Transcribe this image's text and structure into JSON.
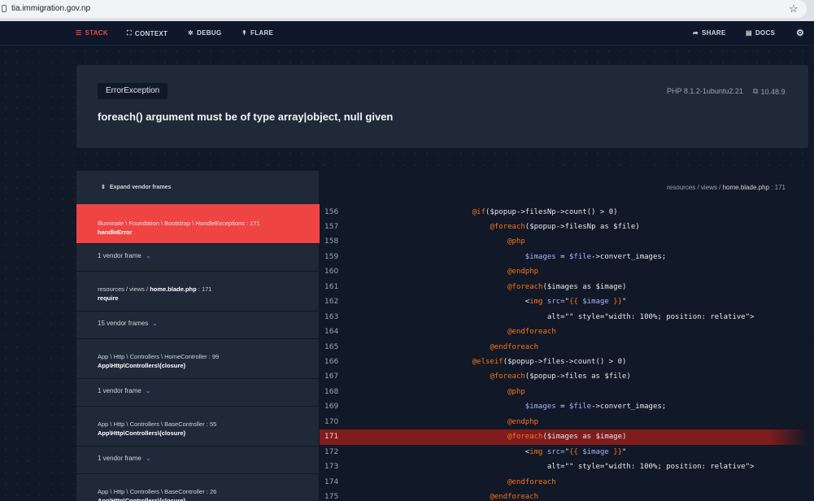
{
  "browser": {
    "url": "tia.immigration.gov.np"
  },
  "nav": {
    "stack": "STACK",
    "context": "CONTEXT",
    "debug": "DEBUG",
    "flare": "FLARE",
    "share": "SHARE",
    "docs": "DOCS"
  },
  "error": {
    "class": "ErrorException",
    "php_version": "PHP 8.1.2-1ubuntu2.21",
    "laravel_version": "10.48.9",
    "message": "foreach() argument must be of type array|object, null given"
  },
  "frames": {
    "expand_label": "Expand vendor frames",
    "items": [
      {
        "type": "frame",
        "path": "Illuminate \\ Foundation \\ Bootstrap \\ HandleExceptions : 171",
        "fn": "handleError",
        "active": true
      },
      {
        "type": "vendor",
        "label": "1 vendor frame"
      },
      {
        "type": "frame",
        "path_prefix": "resources / views / ",
        "path_file": "home.blade.php",
        "path_suffix": " : 171",
        "fn": "require"
      },
      {
        "type": "vendor",
        "label": "15 vendor frames"
      },
      {
        "type": "frame",
        "path": "App \\ Http \\ Controllers \\ HomeController : 99",
        "fn": "App\\Http\\Controllers\\{closure}"
      },
      {
        "type": "vendor",
        "label": "1 vendor frame"
      },
      {
        "type": "frame",
        "path": "App \\ Http \\ Controllers \\ BaseController : 55",
        "fn": "App\\Http\\Controllers\\{closure}"
      },
      {
        "type": "vendor",
        "label": "1 vendor frame"
      },
      {
        "type": "frame",
        "path": "App \\ Http \\ Controllers \\ BaseController : 26",
        "fn": "App\\Http\\Controllers\\{closure}"
      }
    ]
  },
  "code": {
    "file_prefix": "resources / views / ",
    "file_name": "home.blade.php",
    "file_suffix": " : 171",
    "highlight_line": 171,
    "lines": [
      {
        "n": "156",
        "indent": 28,
        "segs": [
          [
            "@if",
            "d"
          ],
          [
            "($popup->filesNp->count() > 0)",
            "t"
          ]
        ]
      },
      {
        "n": "157",
        "indent": 32,
        "segs": [
          [
            "@foreach",
            "d"
          ],
          [
            "($popup->filesNp as $file)",
            "t"
          ]
        ]
      },
      {
        "n": "158",
        "indent": 36,
        "segs": [
          [
            "@php",
            "d"
          ]
        ]
      },
      {
        "n": "159",
        "indent": 40,
        "segs": [
          [
            "$images",
            "v"
          ],
          [
            " = ",
            "t"
          ],
          [
            "$file",
            "v"
          ],
          [
            "->convert_images;",
            "t"
          ]
        ]
      },
      {
        "n": "160",
        "indent": 36,
        "segs": [
          [
            "@endphp",
            "d"
          ]
        ]
      },
      {
        "n": "161",
        "indent": 36,
        "segs": [
          [
            "@foreach",
            "d"
          ],
          [
            "($images as $image)",
            "t"
          ]
        ]
      },
      {
        "n": "162",
        "indent": 40,
        "segs": [
          [
            "<",
            "t"
          ],
          [
            "img",
            "d"
          ],
          [
            " src=",
            "v"
          ],
          [
            "\"",
            "s"
          ],
          [
            "{{ ",
            "d"
          ],
          [
            "$image",
            "v"
          ],
          [
            " }}",
            "d"
          ],
          [
            "\"",
            "s"
          ]
        ]
      },
      {
        "n": "163",
        "indent": 45,
        "segs": [
          [
            "alt=\"\" style=\"width: 100%; position: relative\">",
            "t"
          ]
        ]
      },
      {
        "n": "164",
        "indent": 36,
        "segs": [
          [
            "@endforeach",
            "d"
          ]
        ]
      },
      {
        "n": "165",
        "indent": 32,
        "segs": [
          [
            "@endforeach",
            "d"
          ]
        ]
      },
      {
        "n": "166",
        "indent": 28,
        "segs": [
          [
            "@elseif",
            "d"
          ],
          [
            "($popup->files->count() > 0)",
            "t"
          ]
        ]
      },
      {
        "n": "167",
        "indent": 32,
        "segs": [
          [
            "@foreach",
            "d"
          ],
          [
            "($popup->files as $file)",
            "t"
          ]
        ]
      },
      {
        "n": "168",
        "indent": 36,
        "segs": [
          [
            "@php",
            "d"
          ]
        ]
      },
      {
        "n": "169",
        "indent": 40,
        "segs": [
          [
            "$images",
            "v"
          ],
          [
            " = ",
            "t"
          ],
          [
            "$file",
            "v"
          ],
          [
            "->convert_images;",
            "t"
          ]
        ]
      },
      {
        "n": "170",
        "indent": 36,
        "segs": [
          [
            "@endphp",
            "d"
          ]
        ]
      },
      {
        "n": "171",
        "indent": 36,
        "segs": [
          [
            "@foreach",
            "d"
          ],
          [
            "($images as $image)",
            "t"
          ]
        ]
      },
      {
        "n": "172",
        "indent": 40,
        "segs": [
          [
            "<",
            "t"
          ],
          [
            "img",
            "d"
          ],
          [
            " src=",
            "v"
          ],
          [
            "\"",
            "s"
          ],
          [
            "{{ ",
            "d"
          ],
          [
            "$image",
            "v"
          ],
          [
            " }}",
            "d"
          ],
          [
            "\"",
            "s"
          ]
        ]
      },
      {
        "n": "173",
        "indent": 45,
        "segs": [
          [
            "alt=\"\" style=\"width: 100%; position: relative\">",
            "t"
          ]
        ]
      },
      {
        "n": "174",
        "indent": 36,
        "segs": [
          [
            "@endforeach",
            "d"
          ]
        ]
      },
      {
        "n": "175",
        "indent": 32,
        "segs": [
          [
            "@endforeach",
            "d"
          ]
        ]
      }
    ]
  },
  "colors": {
    "directive": "#f97316",
    "variable": "#a5b4fc",
    "text": "#e5e7eb",
    "string": "#e5e7eb",
    "accent": "#ef4444"
  }
}
